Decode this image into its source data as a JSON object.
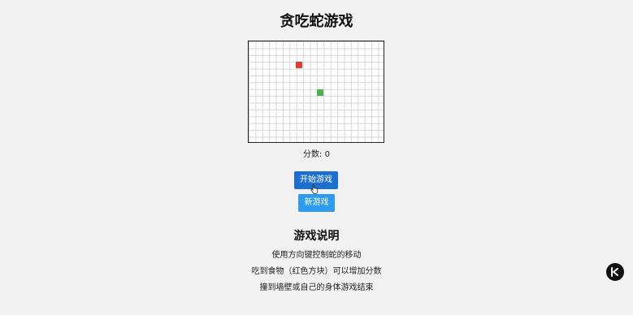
{
  "game": {
    "title": "贪吃蛇游戏",
    "score_label": "分数:",
    "score": "0",
    "board": {
      "cols": 20,
      "rows": 15,
      "snake": [
        {
          "col": 9,
          "row": 7
        }
      ],
      "food": {
        "col": 7,
        "row": 3
      },
      "colors": {
        "snake": "#4caf50",
        "food": "#e53935",
        "grid": "#d6d6d6"
      }
    }
  },
  "buttons": {
    "start_label": "开始游戏",
    "new_label": "新游戏"
  },
  "instructions": {
    "title": "游戏说明",
    "items": [
      "使用方向键控制蛇的移动",
      "吃到食物（红色方块）可以增加分数",
      "撞到墙壁或自己的身体游戏结束"
    ]
  },
  "icons": {
    "floating_button": "k-logo-icon",
    "cursor": "hand-pointer-icon"
  }
}
